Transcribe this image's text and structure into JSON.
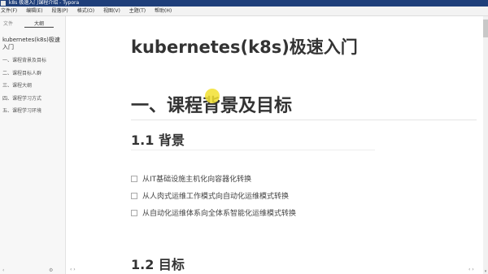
{
  "window": {
    "title": "k8s 极速入门课程介绍 - Typora"
  },
  "menubar": {
    "items": [
      "文件(F)",
      "编辑(E)",
      "段落(P)",
      "格式(O)",
      "视图(V)",
      "主题(T)",
      "帮助(H)"
    ]
  },
  "sidebar": {
    "tabs": {
      "files": "文件",
      "outline": "大纲"
    },
    "outline_title": "kubernetes(k8s)极速入门",
    "items": [
      "一、课程背景及目标",
      "二、课程目标人群",
      "三、课程大纲",
      "四、课程学习方式",
      "五、课程学习环境"
    ],
    "bottom": {
      "collapse": "‹",
      "settings": "⚙"
    }
  },
  "document": {
    "title": "kubernetes(k8s)极速入门",
    "section1": {
      "heading": "一、课程背景及目标"
    },
    "subsection1": {
      "heading": "1.1 背景"
    },
    "bullets": [
      "从IT基础设施主机化向容器化转换",
      "从人肉式运维工作模式向自动化运维模式转换",
      "从自动化运维体系向全体系智能化运维模式转换"
    ],
    "subsection2": {
      "heading": "1.2 目标"
    }
  },
  "footer": {
    "left_arrows": "‹ ›",
    "right_arrows": "‹ ›"
  },
  "colors": {
    "titlebar": "#1f3f7a",
    "cursor_highlight": "#f2e030",
    "text": "#333333"
  }
}
